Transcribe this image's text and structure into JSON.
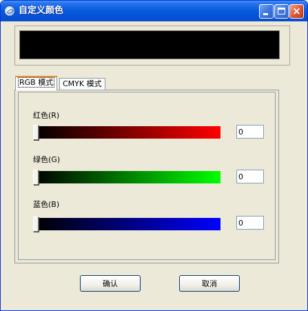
{
  "window": {
    "title": "自定义颜色",
    "icon": "app-icon",
    "controls": {
      "minimize": "minimize",
      "maximize": "maximize",
      "close": "×"
    }
  },
  "preview": {
    "color": "#000000"
  },
  "tabs": [
    {
      "label": "RGB 模式",
      "active": true
    },
    {
      "label": "CMYK 模式",
      "active": false
    }
  ],
  "channels": [
    {
      "label": "红色(R)",
      "value": "0",
      "max_color": "#ff0000"
    },
    {
      "label": "绿色(G)",
      "value": "0",
      "max_color": "#00ff00"
    },
    {
      "label": "蓝色(B)",
      "value": "0",
      "max_color": "#0000ff"
    }
  ],
  "buttons": {
    "ok": "确认",
    "cancel": "取消"
  }
}
